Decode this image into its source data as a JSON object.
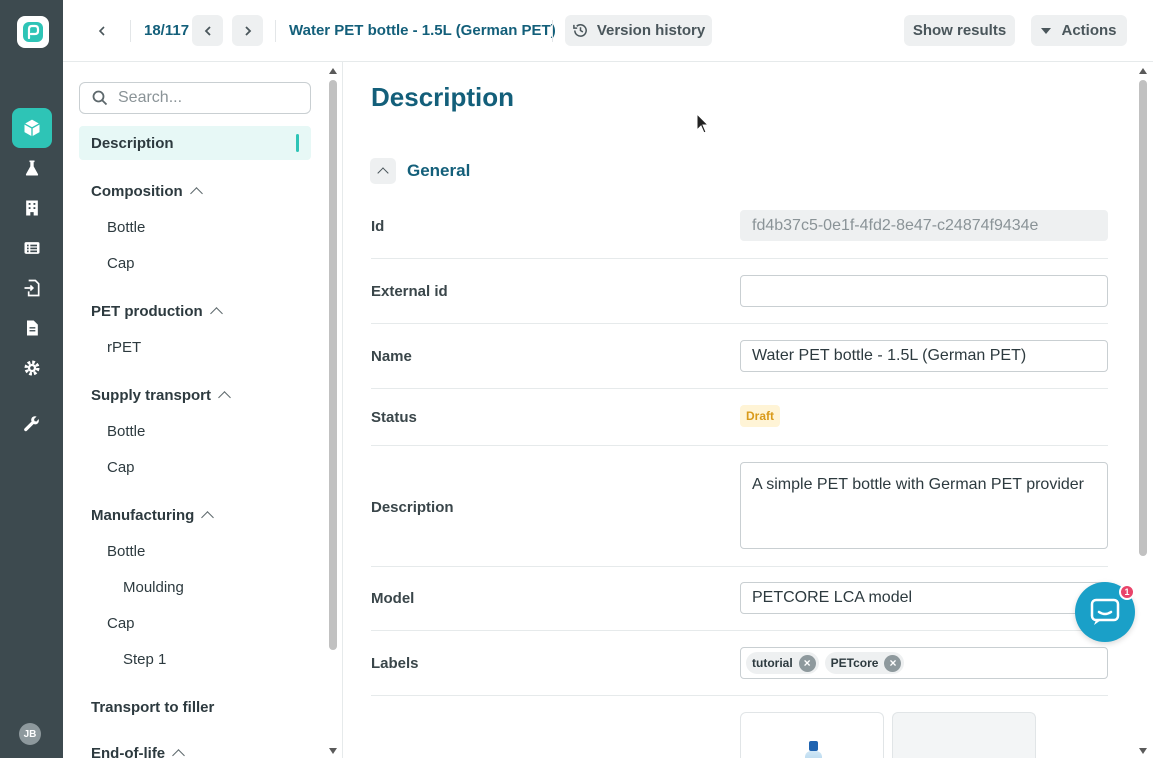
{
  "rail": {
    "avatar_initials": "JB",
    "accent": "#2ec4b6",
    "items": [
      "cube-icon",
      "flask-icon",
      "building-icon",
      "list-icon",
      "import-icon",
      "document-icon",
      "gear-icon",
      "wrench-icon"
    ]
  },
  "header": {
    "pager": "18/117",
    "title": "Water PET bottle - 1.5L (German PET)",
    "version_history": "Version history",
    "show_results": "Show results",
    "actions": "Actions"
  },
  "sidebar": {
    "search_placeholder": "Search...",
    "items": [
      {
        "label": "Description"
      },
      {
        "label": "Composition"
      },
      {
        "label": "Bottle"
      },
      {
        "label": "Cap"
      },
      {
        "label": "PET production"
      },
      {
        "label": "rPET"
      },
      {
        "label": "Supply transport"
      },
      {
        "label": "Bottle"
      },
      {
        "label": "Cap"
      },
      {
        "label": "Manufacturing"
      },
      {
        "label": "Bottle"
      },
      {
        "label": "Moulding"
      },
      {
        "label": "Cap"
      },
      {
        "label": "Step 1"
      },
      {
        "label": "Transport to filler"
      },
      {
        "label": "End-of-life"
      }
    ]
  },
  "main": {
    "page_title": "Description",
    "section_title": "General",
    "fields": {
      "id_label": "Id",
      "id_value": "fd4b37c5-0e1f-4fd2-8e47-c24874f9434e",
      "external_id_label": "External id",
      "external_id_value": "",
      "name_label": "Name",
      "name_value": "Water PET bottle - 1.5L (German PET)",
      "status_label": "Status",
      "status_value": "Draft",
      "description_label": "Description",
      "description_value": "A simple PET bottle with German PET provider",
      "model_label": "Model",
      "model_value": "PETCORE LCA model",
      "labels_label": "Labels",
      "labels": [
        "tutorial",
        "PETcore"
      ]
    }
  },
  "chat": {
    "badge_count": "1"
  }
}
